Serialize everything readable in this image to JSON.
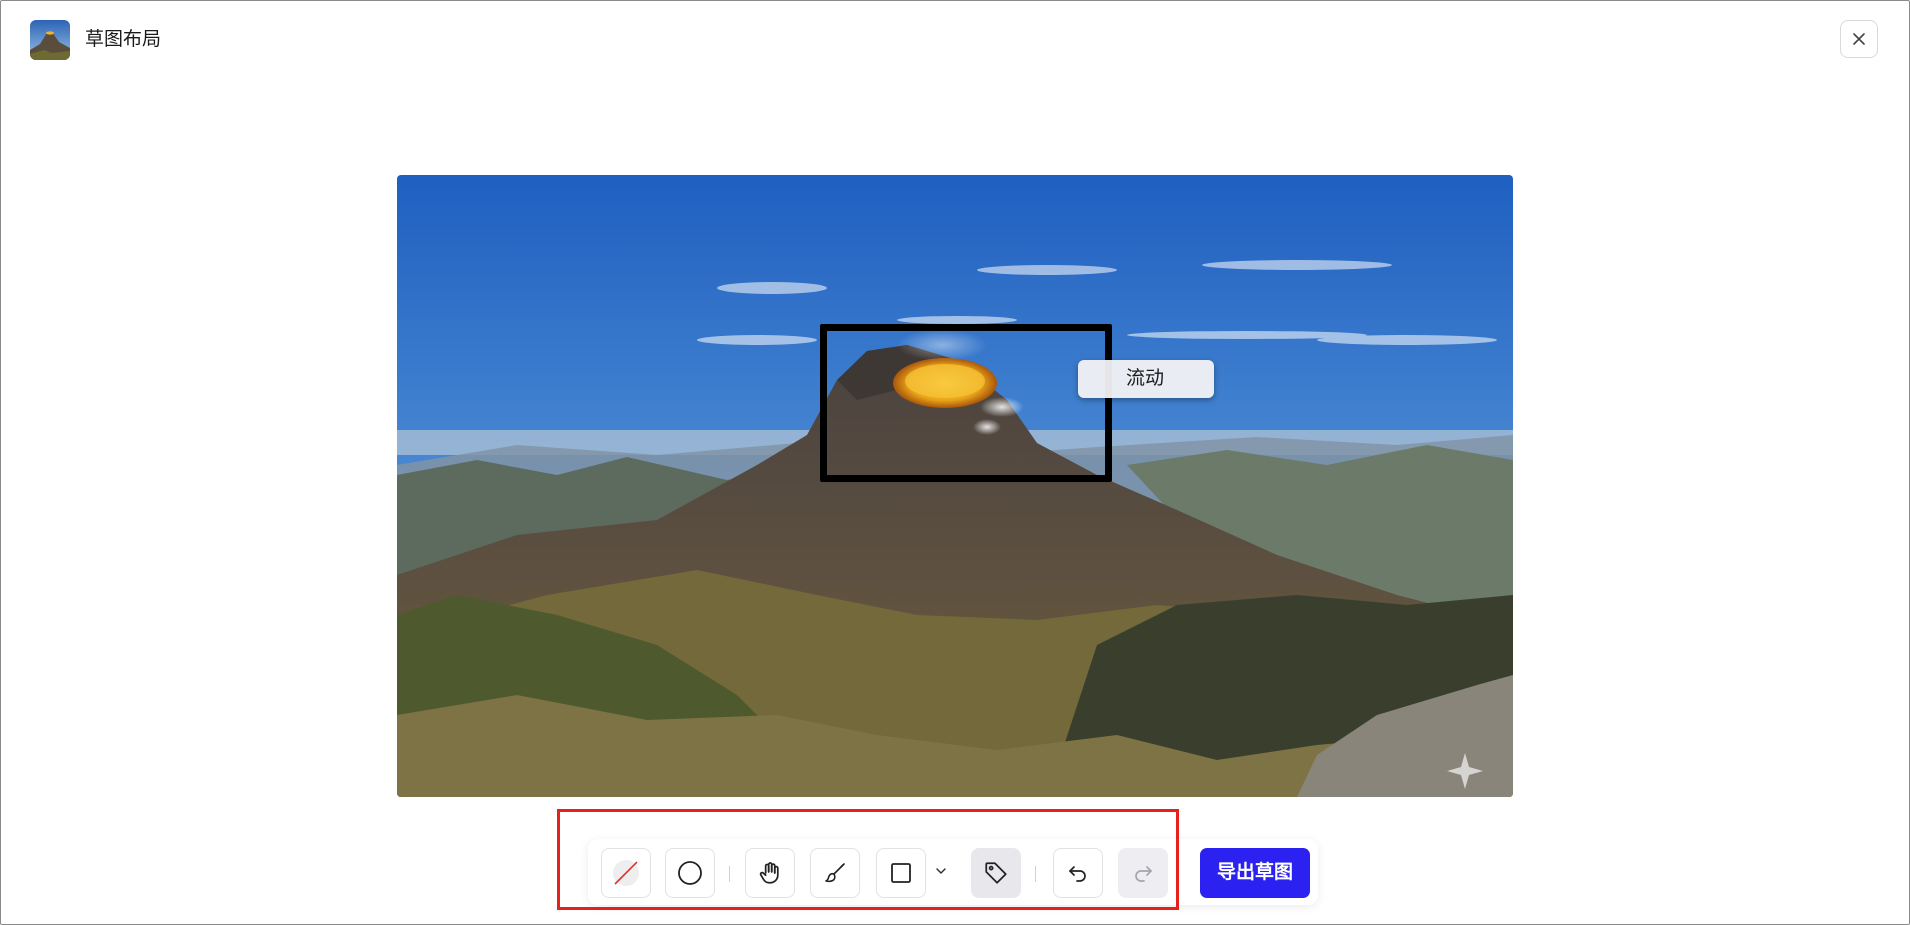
{
  "window": {
    "title": "草图布局"
  },
  "canvas": {
    "annotation_label": "流动"
  },
  "toolbar": {
    "tools": [
      {
        "name": "eraser-tool",
        "icon": "slash-swatch-icon"
      },
      {
        "name": "circle-tool",
        "icon": "circle-icon"
      },
      {
        "name": "pan-tool",
        "icon": "hand-icon"
      },
      {
        "name": "brush-tool",
        "icon": "brush-icon"
      },
      {
        "name": "rectangle-tool",
        "icon": "square-icon",
        "has_dropdown": true
      },
      {
        "name": "tag-tool",
        "icon": "tag-icon",
        "active": true
      },
      {
        "name": "undo-button",
        "icon": "undo-icon"
      },
      {
        "name": "redo-button",
        "icon": "redo-icon",
        "disabled": true
      }
    ],
    "export_label": "导出草图"
  },
  "colors": {
    "accent": "#2b22f2",
    "highlight_border": "#e8201b",
    "selection_box": "#000000"
  }
}
